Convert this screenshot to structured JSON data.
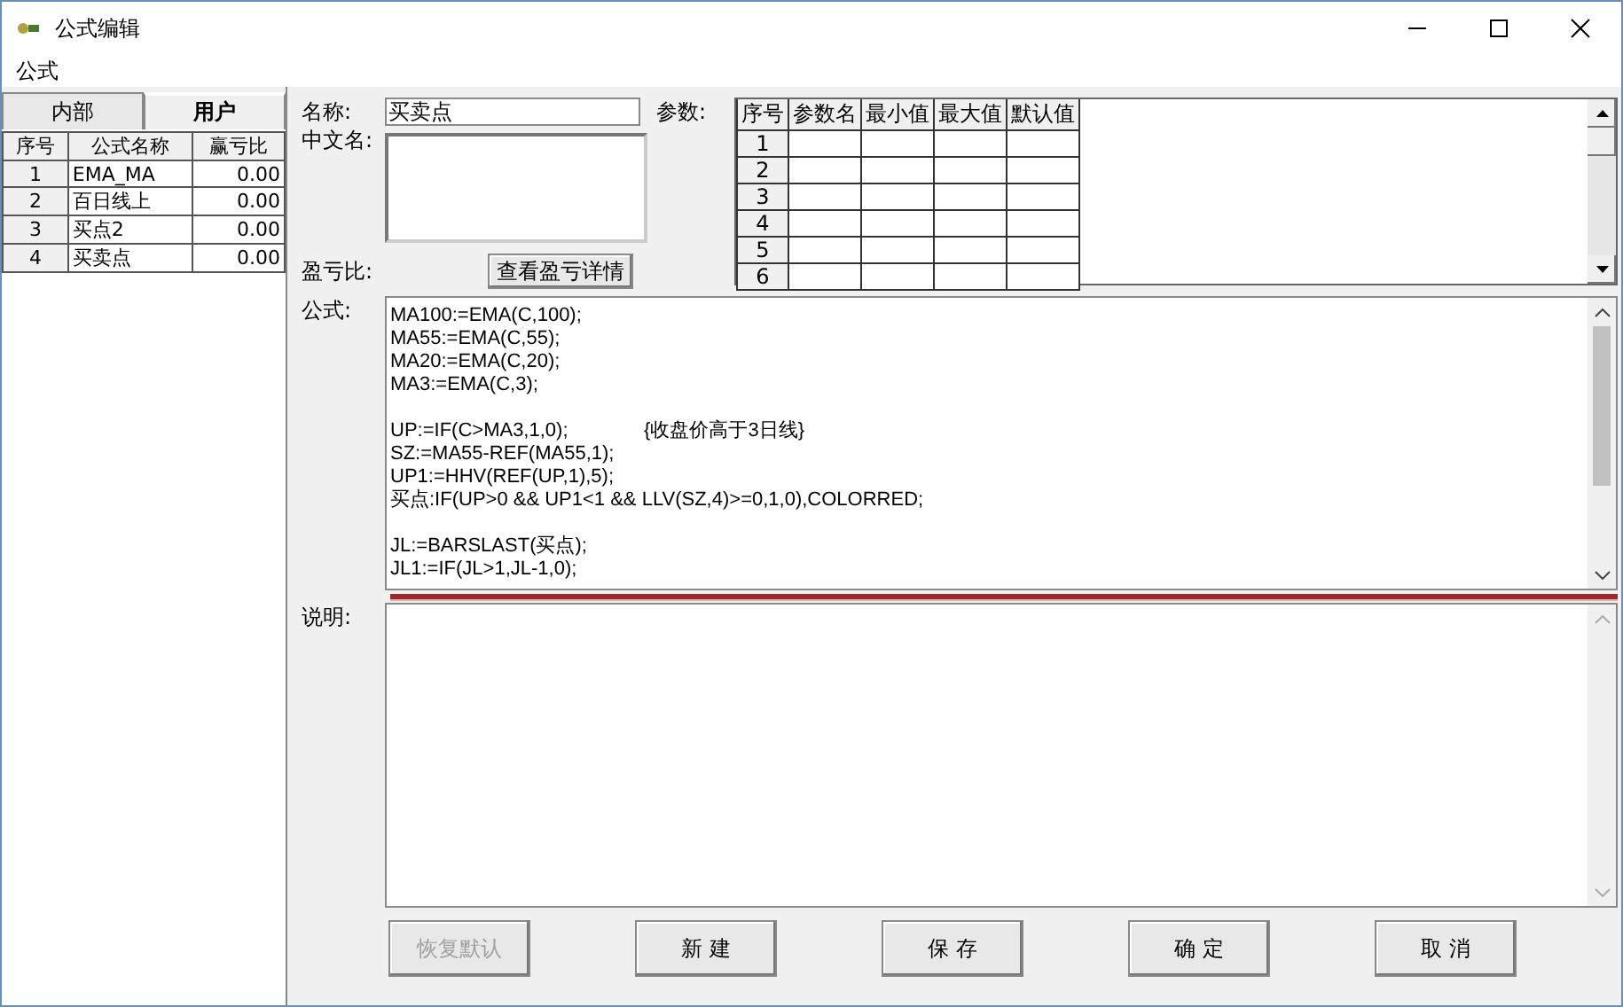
{
  "window": {
    "title": "公式编辑"
  },
  "menu": [
    "公式"
  ],
  "tabs": [
    {
      "label": "内部",
      "selected": false
    },
    {
      "label": "用户",
      "selected": true
    }
  ],
  "formula_list": {
    "columns": [
      "序号",
      "公式名称",
      "赢亏比"
    ],
    "rows": [
      {
        "cells": [
          "1",
          "EMA_MA",
          "0.00"
        ],
        "selected": false
      },
      {
        "cells": [
          "2",
          "百日线上",
          "0.00"
        ],
        "selected": false
      },
      {
        "cells": [
          "3",
          "买点2",
          "0.00"
        ],
        "selected": false
      },
      {
        "cells": [
          "4",
          "买卖点",
          "0.00"
        ],
        "selected": false
      }
    ]
  },
  "name": {
    "label": "名称:",
    "value": "买卖点"
  },
  "chinese_name": {
    "label": "中文名:"
  },
  "profit_ratio": {
    "label": "盈亏比:",
    "button": "查看盈亏详情"
  },
  "params": {
    "label": "参数:",
    "columns": [
      "序号",
      "参数名",
      "最小值",
      "最大值",
      "默认值"
    ],
    "rows": [
      "1",
      "2",
      "3",
      "4",
      "5",
      "6"
    ]
  },
  "formula": {
    "label": "公式:",
    "blocks": [
      [
        "MA100:=EMA(C,100);",
        "MA55:=EMA(C,55);",
        "MA20:=EMA(C,20);",
        "MA3:=EMA(C,3);"
      ],
      [
        "UP:=IF(C>MA3,1,0);              {收盘价高于3日线}",
        "SZ:=MA55-REF(MA55,1);",
        "UP1:=HHV(REF(UP,1),5);",
        "买点:IF(UP>0 && UP1<1 && LLV(SZ,4)>=0,1,0),COLORRED;"
      ],
      [
        "JL:=BARSLAST(买点);",
        "JL1:=IF(JL>1,JL-1,0);"
      ]
    ]
  },
  "description": {
    "label": "说明:"
  },
  "buttons": [
    {
      "label": "恢复默认",
      "disabled": true
    },
    {
      "label": "新  建",
      "disabled": false
    },
    {
      "label": "保  存",
      "disabled": false
    },
    {
      "label": "确  定",
      "disabled": false
    },
    {
      "label": "取  消",
      "disabled": false
    }
  ]
}
